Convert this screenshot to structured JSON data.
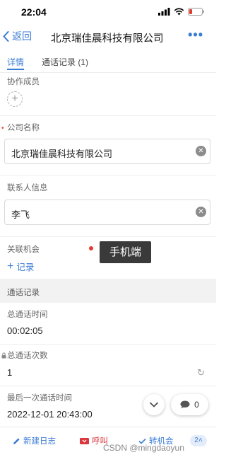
{
  "status_bar": {
    "time": "22:04"
  },
  "nav": {
    "back_label": "返回",
    "title": "北京瑞佳晨科技有限公司",
    "more_label": "•••"
  },
  "tabs": [
    {
      "label": "详情"
    },
    {
      "label": "通话记录 (1)"
    }
  ],
  "fields": {
    "members_label": "协作成员",
    "company_label": "公司名称",
    "company_value": "北京瑞佳晨科技有限公司",
    "contact_label": "联系人信息",
    "contact_value": "李飞",
    "opportunity_label": "关联机会",
    "add_record_label": "记录"
  },
  "tooltip": {
    "text": "手机端"
  },
  "call_section": {
    "header": "通话记录",
    "total_time_label": "总通话时间",
    "total_time_value": "00:02:05",
    "total_count_label": "总通话次数",
    "total_count_value": "1",
    "last_time_label": "最后一次通话时间",
    "last_time_value": "2022-12-01 20:43:00"
  },
  "fab": {
    "comment_count": "0"
  },
  "bottom_bar": {
    "new_log_label": "新建日志",
    "call_label": "呼叫",
    "convert_label": "转机会",
    "more_count": "2"
  },
  "watermark": "CSDN @mingdaoyun",
  "colors": {
    "accent": "#3a7bd5",
    "danger": "#d9363e",
    "section_bg": "#f2f2f2"
  }
}
